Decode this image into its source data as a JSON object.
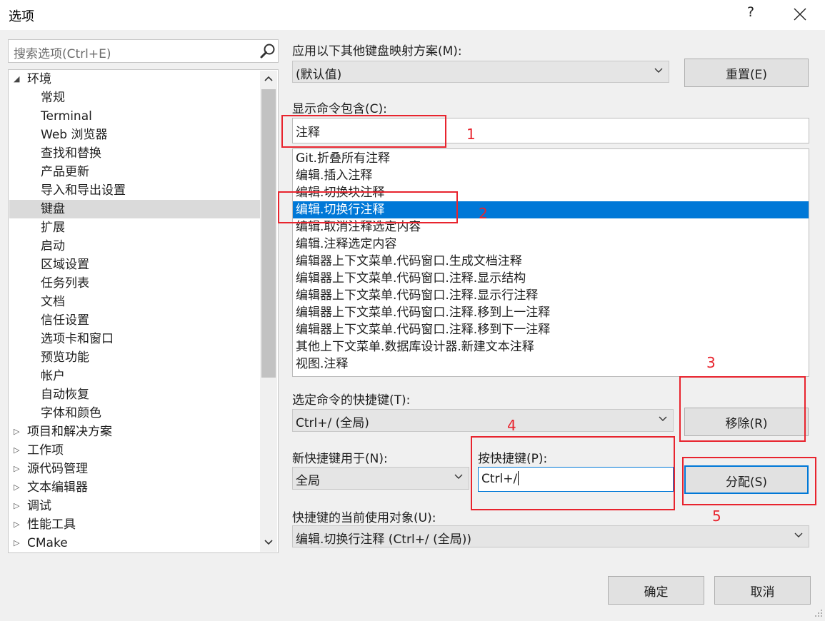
{
  "window": {
    "title": "选项",
    "help_label": "?",
    "close_label": "✕"
  },
  "search": {
    "placeholder": "搜索选项(Ctrl+E)",
    "icon": "search-icon"
  },
  "tree": {
    "items": [
      {
        "label": "环境",
        "level": 0,
        "expanded": true
      },
      {
        "label": "常规",
        "level": 1
      },
      {
        "label": "Terminal",
        "level": 1
      },
      {
        "label": "Web 浏览器",
        "level": 1
      },
      {
        "label": "查找和替换",
        "level": 1
      },
      {
        "label": "产品更新",
        "level": 1
      },
      {
        "label": "导入和导出设置",
        "level": 1
      },
      {
        "label": "键盘",
        "level": 1,
        "selected": true
      },
      {
        "label": "扩展",
        "level": 1
      },
      {
        "label": "启动",
        "level": 1
      },
      {
        "label": "区域设置",
        "level": 1
      },
      {
        "label": "任务列表",
        "level": 1
      },
      {
        "label": "文档",
        "level": 1
      },
      {
        "label": "信任设置",
        "level": 1
      },
      {
        "label": "选项卡和窗口",
        "level": 1
      },
      {
        "label": "预览功能",
        "level": 1
      },
      {
        "label": "帐户",
        "level": 1
      },
      {
        "label": "自动恢复",
        "level": 1
      },
      {
        "label": "字体和颜色",
        "level": 1
      },
      {
        "label": "项目和解决方案",
        "level": 0,
        "expanded": false
      },
      {
        "label": "工作项",
        "level": 0,
        "expanded": false
      },
      {
        "label": "源代码管理",
        "level": 0,
        "expanded": false
      },
      {
        "label": "文本编辑器",
        "level": 0,
        "expanded": false
      },
      {
        "label": "调试",
        "level": 0,
        "expanded": false
      },
      {
        "label": "性能工具",
        "level": 0,
        "expanded": false
      },
      {
        "label": "CMake",
        "level": 0,
        "expanded": false
      }
    ]
  },
  "mapping": {
    "label": "应用以下其他键盘映射方案(M):",
    "value": "(默认值)",
    "reset_label": "重置(E)"
  },
  "show_commands": {
    "label": "显示命令包含(C):",
    "value": "注释"
  },
  "commands": [
    {
      "label": "Git.折叠所有注释"
    },
    {
      "label": "编辑.插入注释"
    },
    {
      "label": "编辑.切换块注释"
    },
    {
      "label": "编辑.切换行注释",
      "selected": true
    },
    {
      "label": "编辑.取消注释选定内容"
    },
    {
      "label": "编辑.注释选定内容"
    },
    {
      "label": "编辑器上下文菜单.代码窗口.生成文档注释"
    },
    {
      "label": "编辑器上下文菜单.代码窗口.注释.显示结构"
    },
    {
      "label": "编辑器上下文菜单.代码窗口.注释.显示行注释"
    },
    {
      "label": "编辑器上下文菜单.代码窗口.注释.移到上一注释"
    },
    {
      "label": "编辑器上下文菜单.代码窗口.注释.移到下一注释"
    },
    {
      "label": "其他上下文菜单.数据库设计器.新建文本注释"
    },
    {
      "label": "视图.注释"
    }
  ],
  "shortcut": {
    "label": "选定命令的快捷键(T):",
    "value": "Ctrl+/ (全局)",
    "remove_label": "移除(R)"
  },
  "new_shortcut": {
    "label": "新快捷键用于(N):",
    "value": "全局"
  },
  "press_keys": {
    "label": "按快捷键(P):",
    "value": "Ctrl+/",
    "assign_label": "分配(S)"
  },
  "current_use": {
    "label": "快捷键的当前使用对象(U):",
    "value": "编辑.切换行注释 (Ctrl+/ (全局))"
  },
  "footer": {
    "ok_label": "确定",
    "cancel_label": "取消"
  },
  "annotations": [
    "1",
    "2",
    "3",
    "4",
    "5"
  ],
  "colors": {
    "selection": "#0078d7",
    "annotation": "#e8242e"
  }
}
